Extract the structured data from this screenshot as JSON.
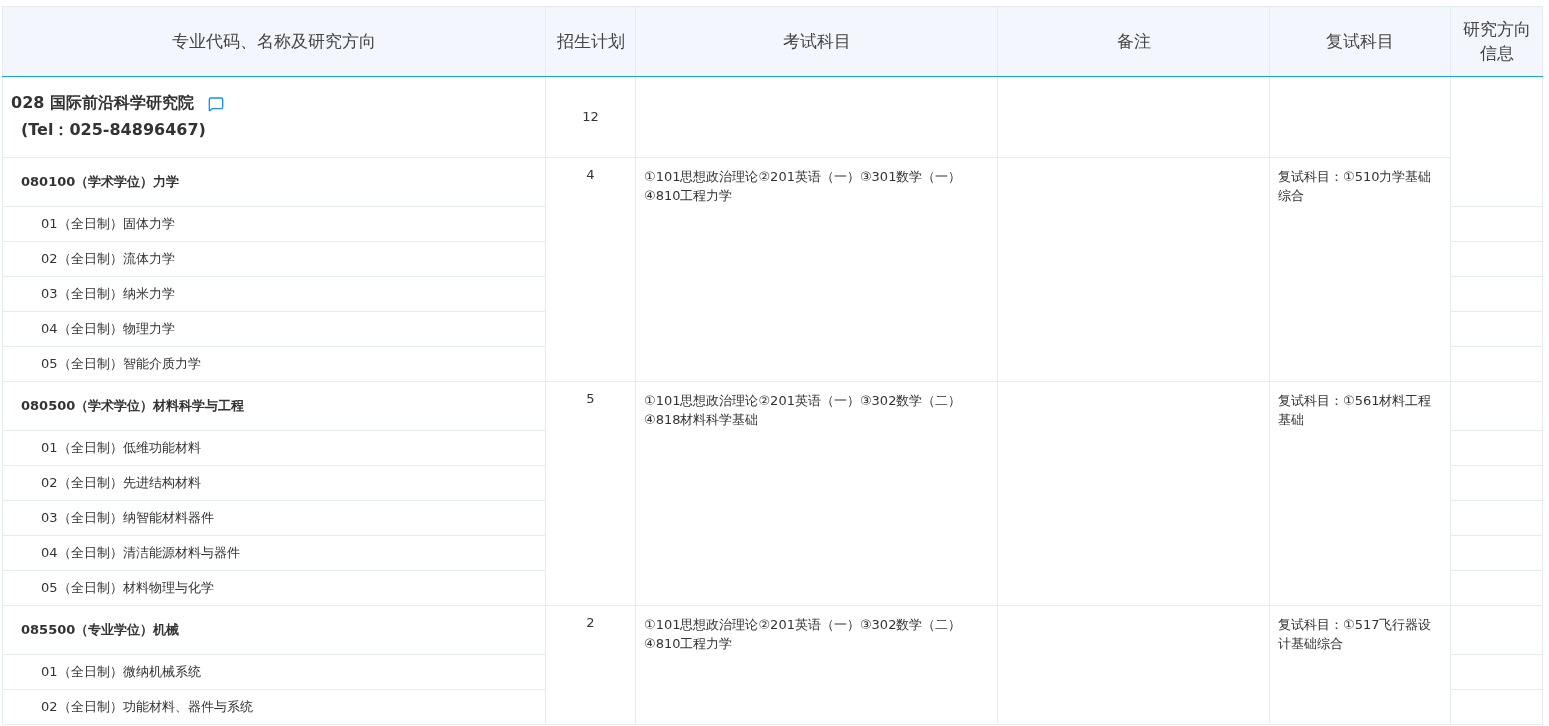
{
  "table": {
    "columns": [
      "专业代码、名称及研究方向",
      "招生计划",
      "考试科目",
      "备注",
      "复试科目",
      "研究方向信息"
    ],
    "school": {
      "name": "028 国际前沿科学研究院",
      "tel": "(Tel：025-84896467)",
      "plan": "12"
    },
    "majors": [
      {
        "title": "080100（学术学位）力学",
        "plan": "4",
        "exams": "①101思想政治理论②201英语（一）③301数学（一）④810工程力学",
        "retest": "复试科目：①510力学基础综合",
        "directions": [
          "01（全日制）固体力学",
          "02（全日制）流体力学",
          "03（全日制）纳米力学",
          "04（全日制）物理力学",
          "05（全日制）智能介质力学"
        ]
      },
      {
        "title": "080500（学术学位）材料科学与工程",
        "plan": "5",
        "exams": "①101思想政治理论②201英语（一）③302数学（二）④818材料科学基础",
        "retest": "复试科目：①561材料工程基础",
        "directions": [
          "01（全日制）低维功能材料",
          "02（全日制）先进结构材料",
          "03（全日制）纳智能材料器件",
          "04（全日制）清洁能源材料与器件",
          "05（全日制）材料物理与化学"
        ]
      },
      {
        "title": "085500（专业学位）机械",
        "plan": "2",
        "exams": "①101思想政治理论②201英语（一）③302数学（二）④810工程力学",
        "retest": "复试科目：①517飞行器设计基础综合",
        "directions": [
          "01（全日制）微纳机械系统",
          "02（全日制）功能材料、器件与系统"
        ]
      }
    ]
  }
}
